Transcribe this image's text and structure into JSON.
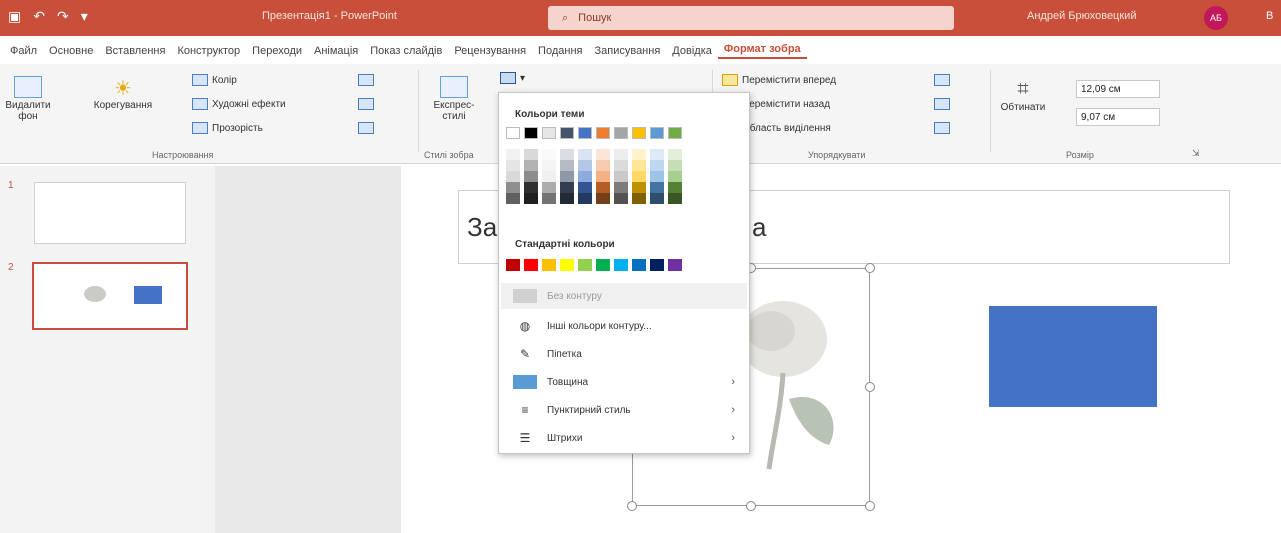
{
  "titlebar": {
    "doc_title": "Презентація1 - PowerPoint",
    "search_placeholder": "Пошук",
    "user_name": "Андрей Брюховецкий",
    "avatar_initials": "АБ",
    "extra": "В"
  },
  "tabs": [
    {
      "label": "Файл"
    },
    {
      "label": "Основне"
    },
    {
      "label": "Вставлення"
    },
    {
      "label": "Конструктор"
    },
    {
      "label": "Переходи"
    },
    {
      "label": "Анімація"
    },
    {
      "label": "Показ слайдів"
    },
    {
      "label": "Рецензування"
    },
    {
      "label": "Подання"
    },
    {
      "label": "Записування"
    },
    {
      "label": "Довідка"
    },
    {
      "label": "Формат зобра",
      "active": true
    }
  ],
  "ribbon": {
    "remove_bg": "Видалити фон",
    "corrections": "Корегування",
    "color": "Колір",
    "artistic": "Художні ефекти",
    "transparency": "Прозорість",
    "adjust_group": "Настроювання",
    "quick_styles": "Експрес-стилі",
    "styles_group": "Стилі зобра",
    "bring_forward": "Перемістити вперед",
    "send_backward": "Перемістити назад",
    "selection_pane": "Область виділення",
    "arrange_group": "Упорядкувати",
    "crop": "Обтинати",
    "height": "12,09 см",
    "width": "9,07 см",
    "size_group": "Розмір"
  },
  "slides": [
    {
      "number": "1"
    },
    {
      "number": "2"
    }
  ],
  "slide": {
    "title_left": "За",
    "title_right": "а"
  },
  "menu": {
    "theme_colors": "Кольори теми",
    "standard_colors": "Стандартні кольори",
    "no_outline": "Без контуру",
    "more_colors": "Інші кольори контуру...",
    "eyedropper": "Піпетка",
    "weight": "Товщина",
    "dashes": "Пунктирний стиль",
    "arrows": "Штрихи"
  },
  "colors": {
    "accent": "#c8503a",
    "shape_blue": "#4472c4",
    "theme": [
      "#ffffff",
      "#000000",
      "#e7e6e6",
      "#44546a",
      "#4472c4",
      "#ed7d31",
      "#a5a5a5",
      "#ffc000",
      "#5b9bd5",
      "#70ad47"
    ],
    "standard": [
      "#c00000",
      "#ff0000",
      "#ffc000",
      "#ffff00",
      "#92d050",
      "#00b050",
      "#00b0f0",
      "#0070c0",
      "#002060",
      "#7030a0"
    ]
  }
}
